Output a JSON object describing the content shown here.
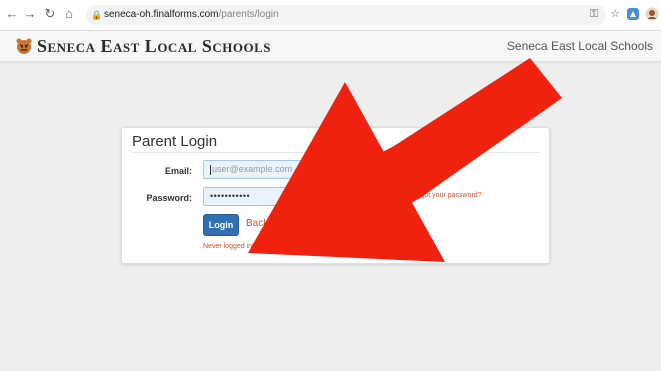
{
  "browser": {
    "url_host": "seneca-oh.finalforms.com",
    "url_path": "/parents/login",
    "back_icon": "back-arrow-icon",
    "forward_icon": "forward-arrow-icon",
    "reload_icon": "reload-icon",
    "home_icon": "home-icon"
  },
  "site": {
    "brand": "Seneca East Local Schools",
    "right_title": "Seneca East Local Schools"
  },
  "login": {
    "title": "Parent Login",
    "email_label": "Email:",
    "email_placeholder": "user@example.com",
    "password_label": "Password:",
    "password_value": "•••••••••••",
    "login_button": "Login",
    "back_link": "Back",
    "never_logged_in": "Never logged in?",
    "forgot_password": "Forgot your password?"
  },
  "colors": {
    "accent_button": "#2f6fb3",
    "link": "#c8562e",
    "annotation_arrow": "#f0220f"
  }
}
